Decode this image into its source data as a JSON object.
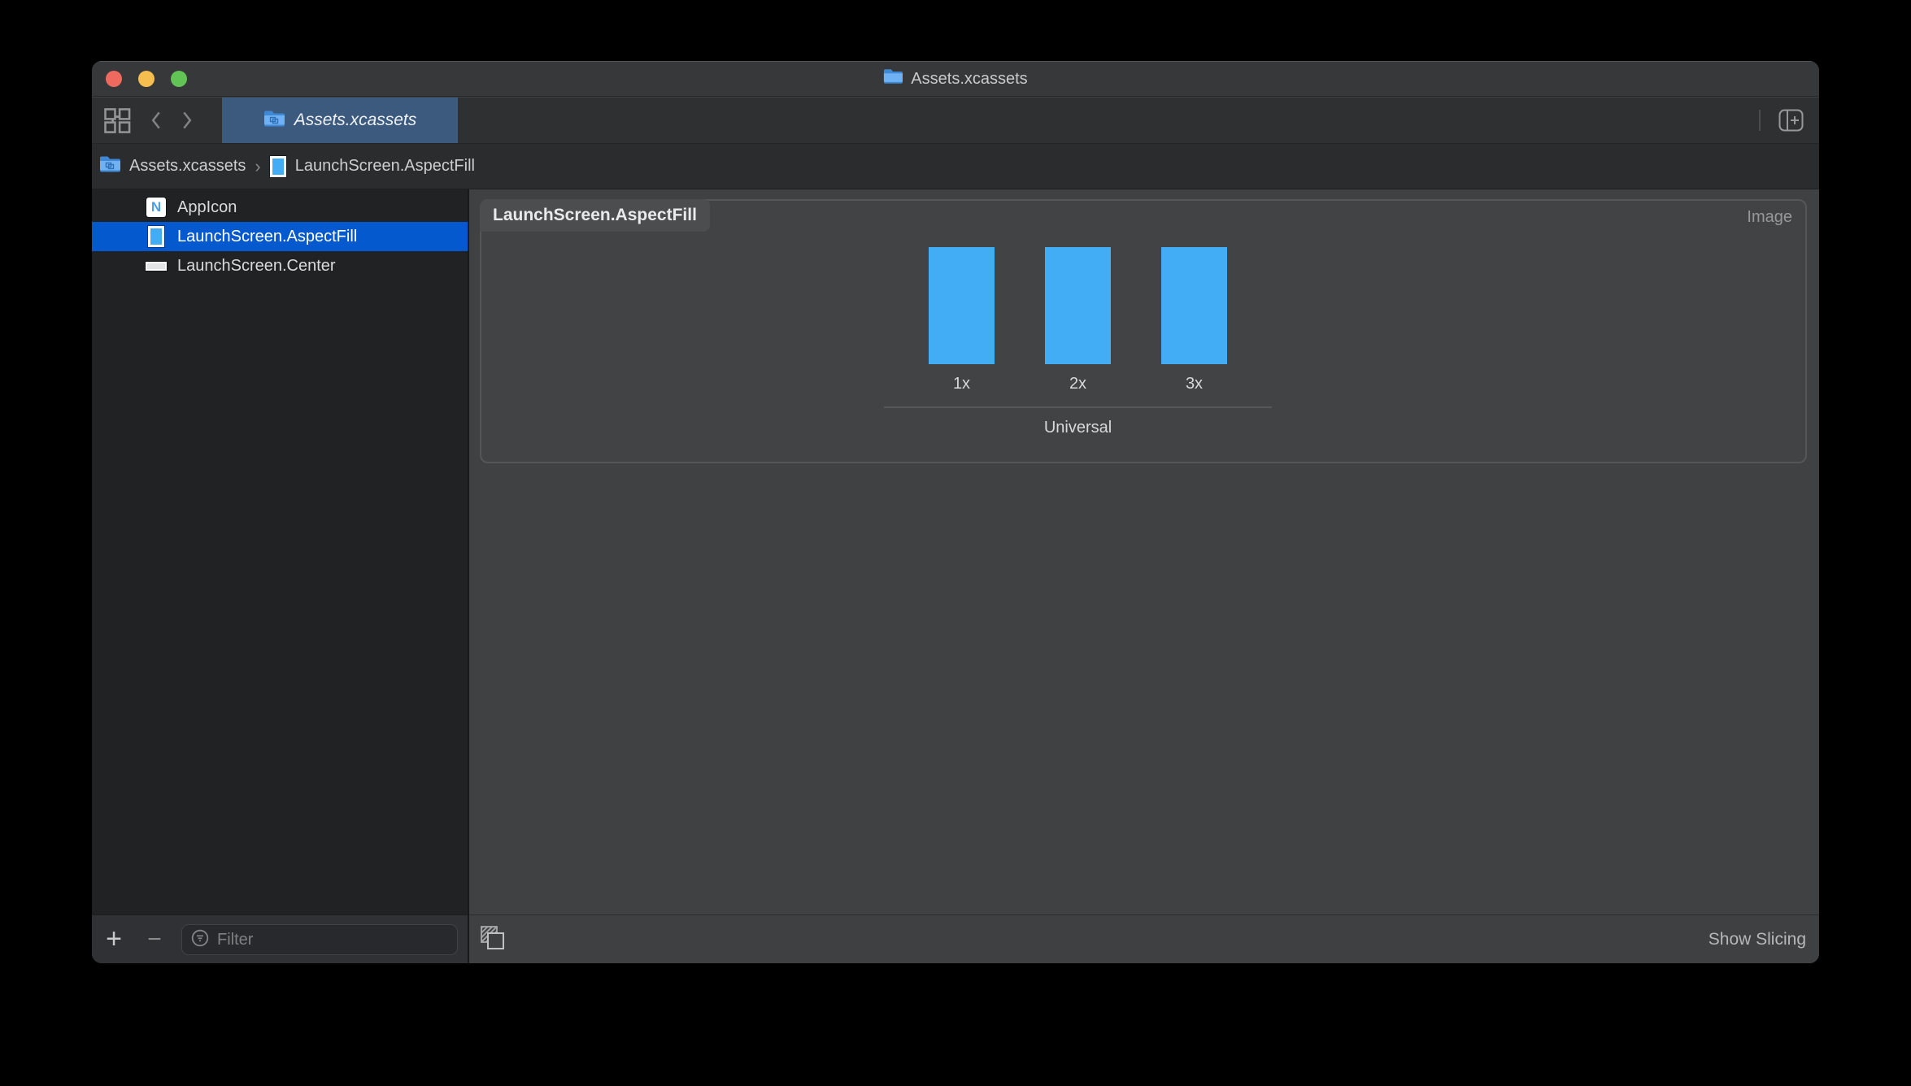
{
  "window": {
    "title": "Assets.xcassets"
  },
  "toolbar": {
    "tab_label": "Assets.xcassets"
  },
  "breadcrumb": {
    "separator": "›",
    "items": [
      {
        "label": "Assets.xcassets"
      },
      {
        "label": "LaunchScreen.AspectFill"
      }
    ]
  },
  "sidebar": {
    "items": [
      {
        "label": "AppIcon",
        "thumb_letter": "N",
        "selected": false
      },
      {
        "label": "LaunchScreen.AspectFill",
        "selected": true
      },
      {
        "label": "LaunchScreen.Center",
        "selected": false
      }
    ],
    "add_label": "+",
    "remove_label": "−",
    "filter_placeholder": "Filter"
  },
  "editor": {
    "asset_title": "LaunchScreen.AspectFill",
    "type_label": "Image",
    "image_set": {
      "scales": [
        {
          "label": "1x"
        },
        {
          "label": "2x"
        },
        {
          "label": "3x"
        }
      ],
      "idiom_label": "Universal"
    },
    "show_slicing_label": "Show Slicing"
  },
  "colors": {
    "asset-blue": "#42adf4",
    "selection-blue": "#0459cf",
    "tab-blue": "#3c5a7e",
    "traffic-red": "#ee6a5f",
    "traffic-yellow": "#f5be4f",
    "traffic-green": "#62c454"
  }
}
